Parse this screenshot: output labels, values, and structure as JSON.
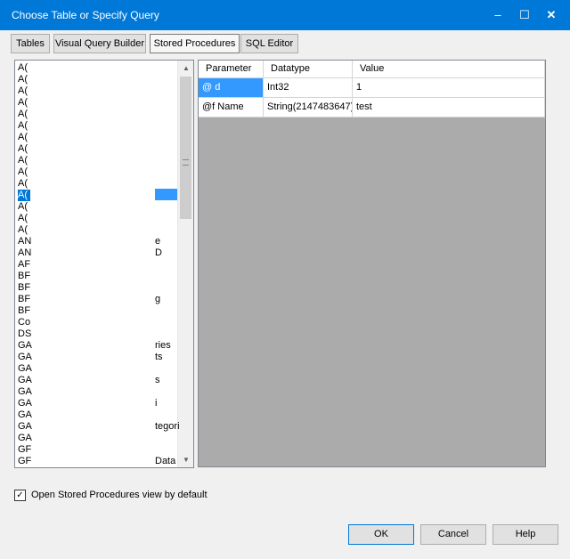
{
  "window": {
    "title": "Choose Table or Specify Query"
  },
  "controls": {
    "minimize": "‒",
    "maximize": "☐",
    "close": "✕"
  },
  "tabs": [
    {
      "label": "Tables"
    },
    {
      "label": "Visual Query Builder"
    },
    {
      "label": "Stored Procedures",
      "active": true
    },
    {
      "label": "SQL Editor"
    }
  ],
  "procedure_list": {
    "items": [
      "A(",
      "A(",
      "A(",
      "A(",
      "A(",
      "A(",
      "A(",
      "A(",
      "A(",
      "A(",
      "A(",
      "A(",
      "A(",
      "A(",
      "A(",
      "AN",
      "AN",
      "AF",
      "BF",
      "BF",
      "BF",
      "BF",
      "Co",
      "DS",
      "GA",
      "GA",
      "GA",
      "GA",
      "GA",
      "GA",
      "GA",
      "GA",
      "GA",
      "GF",
      "GF",
      "GF"
    ],
    "selected_index": 11,
    "right_fragments": [
      {
        "row": 15,
        "text": "e"
      },
      {
        "row": 16,
        "text": "D"
      },
      {
        "row": 20,
        "text": "g"
      },
      {
        "row": 24,
        "text": "ries"
      },
      {
        "row": 25,
        "text": "ts"
      },
      {
        "row": 27,
        "text": "s"
      },
      {
        "row": 29,
        "text": "i"
      },
      {
        "row": 31,
        "text": "tegori"
      },
      {
        "row": 34,
        "text": "Data"
      }
    ]
  },
  "parameters_grid": {
    "headers": [
      "Parameter",
      "Datatype",
      "Value"
    ],
    "rows": [
      {
        "parameter": "@ d",
        "datatype": "Int32",
        "value": "1"
      },
      {
        "parameter": "@f Name",
        "datatype": "String(2147483647)",
        "value": "test"
      }
    ]
  },
  "options": {
    "default_view_label": "Open Stored Procedures view by default",
    "checked": true
  },
  "buttons": {
    "ok": "OK",
    "cancel": "Cancel",
    "help": "Help"
  }
}
